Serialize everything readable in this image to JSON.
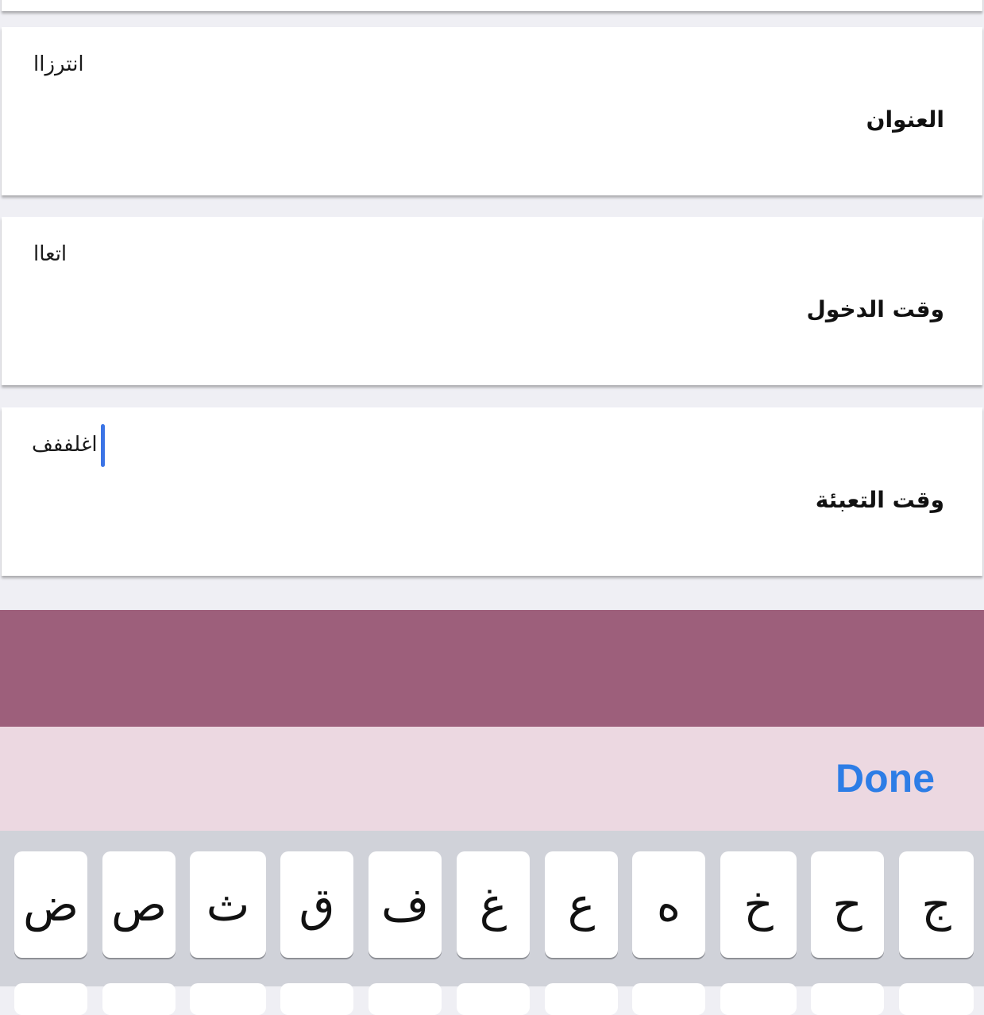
{
  "fields": [
    {
      "label": "العنوان",
      "value": "انترزاا"
    },
    {
      "label": "وقت الدخول",
      "value": "اتعاا"
    },
    {
      "label": "وقت التعبئة",
      "value": "اغلففف"
    }
  ],
  "accessory_bar": {
    "done_label": "Done"
  },
  "keyboard": {
    "row1": [
      "ض",
      "ص",
      "ث",
      "ق",
      "ف",
      "غ",
      "ع",
      "ه",
      "خ",
      "ح",
      "ج"
    ]
  },
  "colors": {
    "accent_bar": "#9d5f7b",
    "done_blue": "#2d7de6",
    "cursor_blue": "#3b74e6",
    "accessory_bg": "#ecd8e1"
  }
}
